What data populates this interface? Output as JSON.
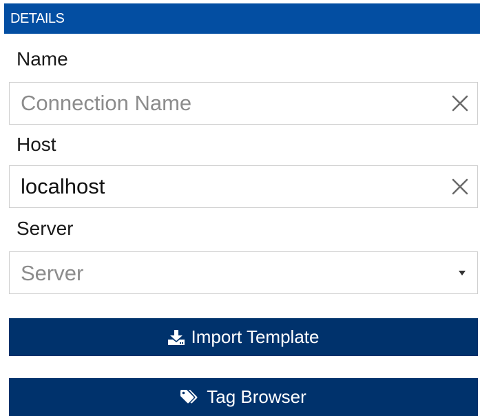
{
  "header": {
    "title": "DETAILS"
  },
  "fields": {
    "name": {
      "label": "Name",
      "value": "",
      "placeholder": "Connection Name"
    },
    "host": {
      "label": "Host",
      "value": "localhost",
      "placeholder": ""
    },
    "server": {
      "label": "Server",
      "selected": "Server"
    }
  },
  "buttons": {
    "import_template": "Import Template",
    "tag_browser": "Tag Browser"
  },
  "icons": {
    "clear": "close-icon",
    "dropdown": "caret-down-icon",
    "import": "download-icon",
    "tag": "tag-icon"
  },
  "colors": {
    "header_bg": "#034ea2",
    "button_bg": "#00326c",
    "border": "#cfcfcf",
    "placeholder": "#8c8c8c"
  }
}
